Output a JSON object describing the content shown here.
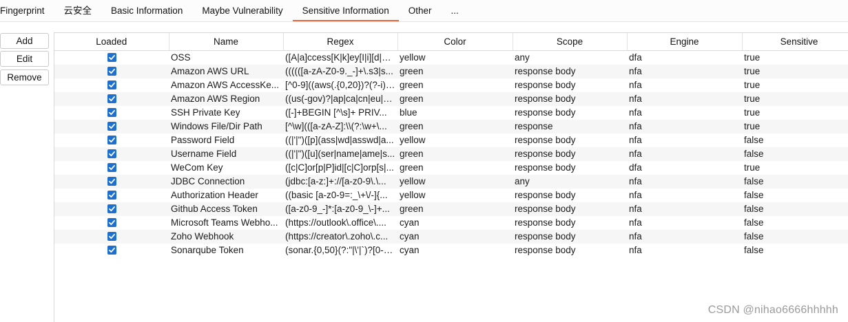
{
  "tabs": [
    {
      "label": "Fingerprint"
    },
    {
      "label": "云安全"
    },
    {
      "label": "Basic Information"
    },
    {
      "label": "Maybe Vulnerability"
    },
    {
      "label": "Sensitive Information",
      "active": true
    },
    {
      "label": "Other"
    },
    {
      "label": "..."
    }
  ],
  "buttons": {
    "add": "Add",
    "edit": "Edit",
    "remove": "Remove"
  },
  "table": {
    "headers": [
      "Loaded",
      "Name",
      "Regex",
      "Color",
      "Scope",
      "Engine",
      "Sensitive"
    ],
    "rows": [
      {
        "loaded": true,
        "name": "OSS",
        "regex": "([A|a]ccess[K|k]ey[I|i][d|D...",
        "color": "yellow",
        "scope": "any",
        "engine": "dfa",
        "sensitive": "true"
      },
      {
        "loaded": true,
        "name": "Amazon AWS URL",
        "regex": "((((([a-zA-Z0-9._-]+\\.s3|s...",
        "color": "green",
        "scope": "response body",
        "engine": "nfa",
        "sensitive": "true"
      },
      {
        "loaded": true,
        "name": "Amazon AWS AccessKe...",
        "regex": "[^0-9]((aws(.{0,20})?(?-i)[...",
        "color": "green",
        "scope": "response body",
        "engine": "nfa",
        "sensitive": "true"
      },
      {
        "loaded": true,
        "name": "Amazon AWS Region",
        "regex": "((us(-gov)?|ap|ca|cn|eu|s...",
        "color": "green",
        "scope": "response body",
        "engine": "nfa",
        "sensitive": "true"
      },
      {
        "loaded": true,
        "name": "SSH Private Key",
        "regex": "([-]+BEGIN [^\\s]+ PRIV...",
        "color": "blue",
        "scope": "response body",
        "engine": "nfa",
        "sensitive": "true"
      },
      {
        "loaded": true,
        "name": "Windows File/Dir Path",
        "regex": "[^\\w](([a-zA-Z]:\\\\(?:\\w+\\...",
        "color": "green",
        "scope": "response",
        "engine": "nfa",
        "sensitive": "true"
      },
      {
        "loaded": true,
        "name": "Password Field",
        "regex": "((|'|\")([p](ass|wd|asswd|a...",
        "color": "yellow",
        "scope": "response body",
        "engine": "nfa",
        "sensitive": "false"
      },
      {
        "loaded": true,
        "name": "Username Field",
        "regex": "((|'|\")([u](ser|name|ame|s...",
        "color": "green",
        "scope": "response body",
        "engine": "nfa",
        "sensitive": "false"
      },
      {
        "loaded": true,
        "name": "WeCom Key",
        "regex": "([c|C]or[p|P]id|[c|C]orp[s|...",
        "color": "green",
        "scope": "response body",
        "engine": "dfa",
        "sensitive": "true"
      },
      {
        "loaded": true,
        "name": "JDBC Connection",
        "regex": "(jdbc:[a-z:]+://[a-z0-9\\.\\...",
        "color": "yellow",
        "scope": "any",
        "engine": "nfa",
        "sensitive": "false"
      },
      {
        "loaded": true,
        "name": "Authorization Header",
        "regex": "((basic [a-z0-9=:_\\+\\/-]{...",
        "color": "yellow",
        "scope": "response body",
        "engine": "nfa",
        "sensitive": "false"
      },
      {
        "loaded": true,
        "name": "Github Access Token",
        "regex": "([a-z0-9_-]*:[a-z0-9_\\-]+...",
        "color": "green",
        "scope": "response body",
        "engine": "nfa",
        "sensitive": "false"
      },
      {
        "loaded": true,
        "name": "Microsoft Teams Webho...",
        "regex": "(https://outlook\\.office\\....",
        "color": "cyan",
        "scope": "response body",
        "engine": "nfa",
        "sensitive": "false"
      },
      {
        "loaded": true,
        "name": "Zoho Webhook",
        "regex": "(https://creator\\.zoho\\.c...",
        "color": "cyan",
        "scope": "response body",
        "engine": "nfa",
        "sensitive": "false"
      },
      {
        "loaded": true,
        "name": "Sonarqube Token",
        "regex": "(sonar.{0,50}(?:\"|\\'|`)?[0-9...",
        "color": "cyan",
        "scope": "response body",
        "engine": "nfa",
        "sensitive": "false"
      }
    ]
  },
  "watermark": "CSDN @nihao6666hhhhh",
  "icons": {
    "checkbox": "checkbox-checked-icon"
  },
  "colors": {
    "accent": "#e8673c",
    "checkbox": "#1f6fce"
  }
}
